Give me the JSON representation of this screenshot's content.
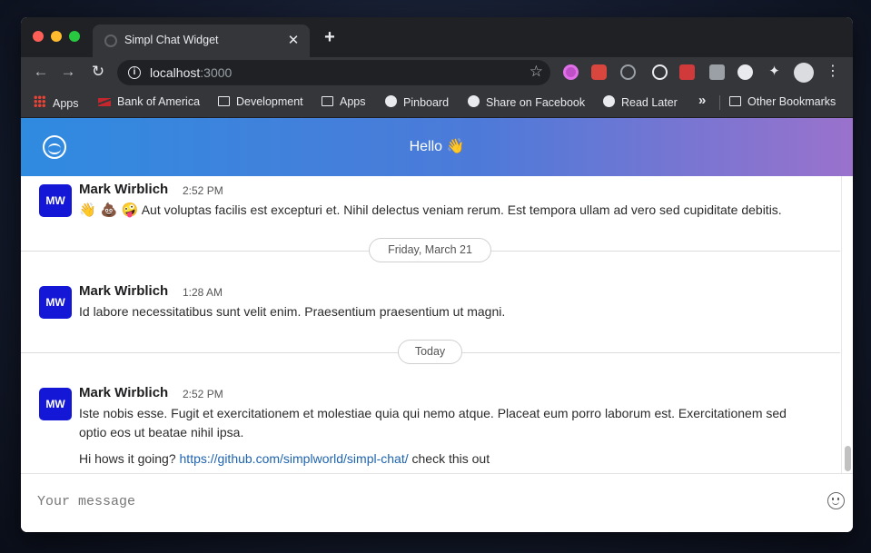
{
  "browser": {
    "tab_title": "Simpl Chat Widget",
    "tab_close": "✕",
    "new_tab": "+",
    "url_host": "localhost",
    "url_port": ":3000",
    "nav": {
      "back": "←",
      "forward": "→",
      "reload": "↻",
      "star": "☆",
      "menu": "⋮",
      "extensions": "✦"
    },
    "bookmarks": [
      "Apps",
      "Bank of America",
      "Development",
      "Apps",
      "Pinboard",
      "Share on Facebook",
      "Read Later"
    ],
    "bookmarks_more": "»",
    "other_bookmarks": "Other Bookmarks"
  },
  "app": {
    "header_title": "Hello 👋",
    "composer_placeholder": "Your message",
    "messages": [
      {
        "avatar": "MW",
        "author": "Mark Wirblich",
        "time": "2:52 PM",
        "emojis": "👋 💩 🤪",
        "text": "Aut voluptas facilis est excepturi et. Nihil delectus veniam rerum. Est tempora ullam ad vero sed cupiditate debitis."
      },
      {
        "avatar": "MW",
        "author": "Mark Wirblich",
        "time": "1:28 AM",
        "text": "Id labore necessitatibus sunt velit enim. Praesentium praesentium ut magni."
      },
      {
        "avatar": "MW",
        "author": "Mark Wirblich",
        "time": "2:52 PM",
        "text": "Iste nobis esse. Fugit et exercitationem et molestiae quia qui nemo atque. Placeat eum porro laborum est. Exercitationem sed optio eos ut beatae nihil ipsa.",
        "followup_prefix": "Hi hows it going?",
        "followup_link": "https://github.com/simplworld/simpl-chat/",
        "followup_suffix": "check this out"
      }
    ],
    "date_dividers": [
      "Friday, March 21",
      "Today"
    ]
  },
  "colors": {
    "header_gradient_start": "#2f8be0",
    "header_gradient_end": "#9a72cc",
    "avatar_bg": "#1418d6",
    "link": "#1e63b0"
  }
}
